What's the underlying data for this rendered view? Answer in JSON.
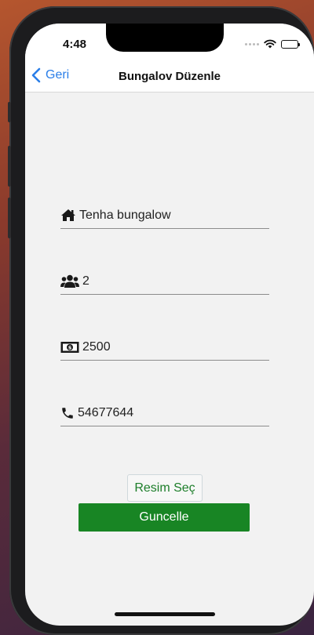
{
  "status_bar": {
    "time": "4:48"
  },
  "nav": {
    "back_label": "Geri",
    "title": "Bungalov Düzenle"
  },
  "form": {
    "name": {
      "value": "Tenha bungalow",
      "icon": "home-icon"
    },
    "capacity": {
      "value": "2",
      "icon": "users-icon"
    },
    "price": {
      "value": "2500",
      "icon": "money-icon"
    },
    "phone": {
      "value": "54677644",
      "icon": "phone-icon"
    }
  },
  "buttons": {
    "select_image": "Resim Seç",
    "update": "Guncelle"
  },
  "colors": {
    "accent_blue": "#2a7ee8",
    "primary_green": "#188524",
    "link_green": "#1d7e2a"
  }
}
